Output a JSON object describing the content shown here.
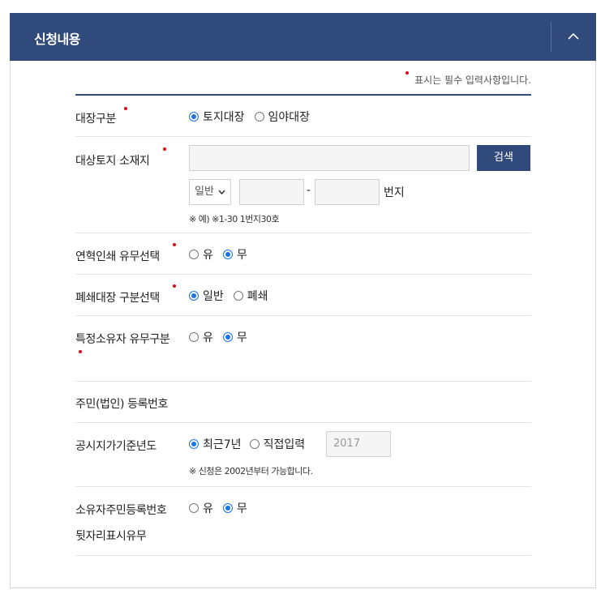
{
  "header": {
    "title": "신청내용",
    "collapse_icon": "chevron-up-icon"
  },
  "required_note": "표시는 필수 입력사항입니다.",
  "colors": {
    "primary": "#304a7b",
    "required": "#e60012",
    "radio_selected": "#1a73e8"
  },
  "ledger_type": {
    "label": "대장구분",
    "options": [
      "토지대장",
      "임야대장"
    ],
    "selected": "토지대장"
  },
  "location": {
    "label": "대상토지 소재지",
    "address_value": "",
    "search_button": "검색",
    "lot_type": "일반",
    "main_number": "",
    "dash": "-",
    "sub_number": "",
    "unit": "번지",
    "hint": "※ 예) ※1-30 1번지30호"
  },
  "history_print": {
    "label": "연혁인쇄 유무선택",
    "options": [
      "유",
      "무"
    ],
    "selected": "무"
  },
  "closed_ledger": {
    "label": "폐쇄대장 구분선택",
    "options": [
      "일반",
      "폐쇄"
    ],
    "selected": "일반"
  },
  "owner_presence": {
    "label": "특정소유자 유무구분",
    "options": [
      "유",
      "무"
    ],
    "selected": "무"
  },
  "resident_number": {
    "label": "주민(법인) 등록번호"
  },
  "price_year": {
    "label": "공시지가기준년도",
    "options": [
      "최근7년",
      "직접입력"
    ],
    "selected": "최근7년",
    "year_value": "2017",
    "hint": "※ 신청은 2002년부터 가능합니다."
  },
  "owner_id_display": {
    "label_line1": "소유자주민등록번호",
    "label_line2": "뒷자리표시유무",
    "options": [
      "유",
      "무"
    ],
    "selected": "무"
  }
}
